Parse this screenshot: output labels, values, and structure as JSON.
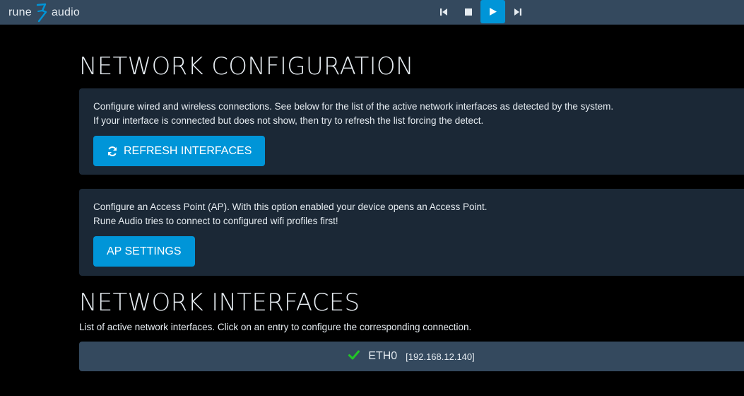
{
  "app": {
    "logo_left": "rune",
    "logo_right": "audio",
    "logo_icon": "rune-logo-icon"
  },
  "playback": {
    "prev_icon": "skip-previous-icon",
    "stop_icon": "stop-icon",
    "play_icon": "play-icon",
    "next_icon": "skip-next-icon",
    "active_color": "#0095d8"
  },
  "network_config": {
    "title": "NETWORK CONFIGURATION",
    "panel1": {
      "line1": "Configure wired and wireless connections. See below for the list of the active network interfaces as detected by the system.",
      "line2": "If your interface is connected but does not show, then try to refresh the list forcing the detect.",
      "button_label": "REFRESH INTERFACES",
      "button_icon": "refresh-icon"
    },
    "panel2": {
      "line1": "Configure an Access Point (AP). With this option enabled your device opens an Access Point.",
      "line2": "Rune Audio tries to connect to configured wifi profiles first!",
      "button_label": "AP SETTINGS"
    }
  },
  "network_interfaces": {
    "title": "NETWORK INTERFACES",
    "hint": "List of active network interfaces. Click on an entry to configure the corresponding connection.",
    "items": [
      {
        "name": "ETH0",
        "ip": "[192.168.12.140]",
        "status_icon": "check-icon",
        "status_color": "#22c527"
      }
    ]
  },
  "colors": {
    "accent": "#0095d8",
    "topbar": "#34495e",
    "panel": "#1b2836"
  }
}
